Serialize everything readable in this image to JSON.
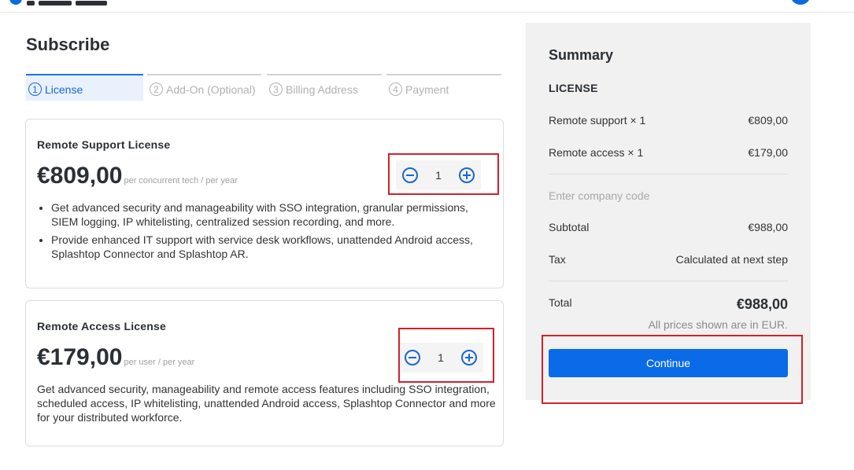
{
  "page": {
    "title": "Subscribe"
  },
  "steps": [
    {
      "num": "1",
      "label": "License",
      "active": true
    },
    {
      "num": "2",
      "label": "Add-On (Optional)",
      "active": false
    },
    {
      "num": "3",
      "label": "Billing Address",
      "active": false
    },
    {
      "num": "4",
      "label": "Payment",
      "active": false
    }
  ],
  "licenses": [
    {
      "name": "Remote Support License",
      "price": "€809,00",
      "unit": "per concurrent tech / per year",
      "quantity": "1",
      "bullets": [
        "Get advanced security and manageability with SSO integration, granular permissions, SIEM logging, IP whitelisting, centralized session recording, and more.",
        "Provide enhanced IT support with service desk workflows, unattended Android access, Splashtop Connector and Splashtop AR."
      ]
    },
    {
      "name": "Remote Access License",
      "price": "€179,00",
      "unit": "per user / per year",
      "quantity": "1",
      "description": "Get advanced security, manageability and remote access features including SSO integration, scheduled access, IP whitelisting, unattended Android access, Splashtop Connector and more for your distributed workforce."
    }
  ],
  "summary": {
    "title": "Summary",
    "section": "LICENSE",
    "items": [
      {
        "label": "Remote support  ×  1",
        "amount": "€809,00"
      },
      {
        "label": "Remote access  ×  1",
        "amount": "€179,00"
      }
    ],
    "company_code_placeholder": "Enter company code",
    "subtotal_label": "Subtotal",
    "subtotal": "€988,00",
    "tax_label": "Tax",
    "tax": "Calculated at next step",
    "total_label": "Total",
    "total": "€988,00",
    "note": "All prices shown are in EUR.",
    "continue_label": "Continue"
  },
  "colors": {
    "accent": "#0a6be8",
    "highlight": "#d4202a"
  }
}
